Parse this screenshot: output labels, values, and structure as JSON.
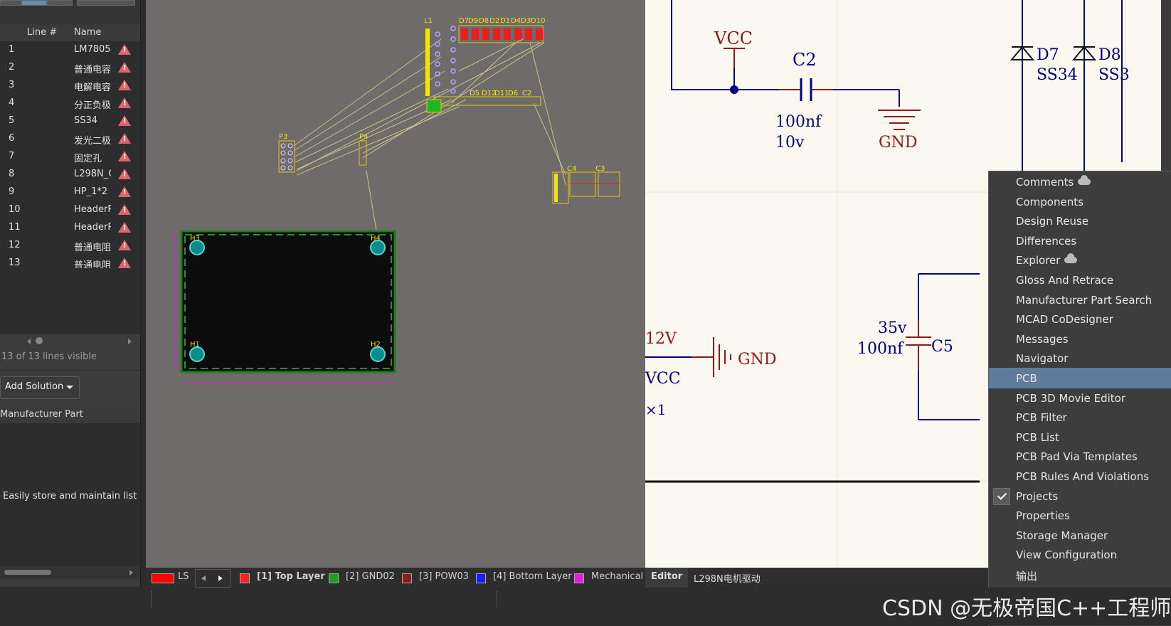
{
  "components_panel": {
    "columns": {
      "line": "Line #",
      "name": "Name"
    },
    "rows": [
      {
        "num": "1",
        "name": "LM7805"
      },
      {
        "num": "2",
        "name": "普通电容"
      },
      {
        "num": "3",
        "name": "电解电容"
      },
      {
        "num": "4",
        "name": "分正负极"
      },
      {
        "num": "5",
        "name": "SS34"
      },
      {
        "num": "6",
        "name": "发光二极"
      },
      {
        "num": "7",
        "name": "固定孔"
      },
      {
        "num": "8",
        "name": "L298N_C"
      },
      {
        "num": "9",
        "name": "HP_1*2"
      },
      {
        "num": "10",
        "name": "HeaderP"
      },
      {
        "num": "11",
        "name": "HeaderP"
      },
      {
        "num": "12",
        "name": "普通电阻"
      },
      {
        "num": "13",
        "name": "普通电阻"
      }
    ],
    "lines_visible": "13 of 13 lines visible",
    "add_solution": "Add Solution",
    "manufacturer_part": "Manufacturer Part",
    "hint": "Easily store and maintain list"
  },
  "pcb": {
    "labels": [
      "L1",
      "D7",
      "D9",
      "D8",
      "D2",
      "D1",
      "D4",
      "D3",
      "D10",
      "D5",
      "D12",
      "D11",
      "D6",
      "C2",
      "P3",
      "P4",
      "H3",
      "H4",
      "H1",
      "H2",
      "C4",
      "C3"
    ],
    "layer_tabs": [
      {
        "label": "LS",
        "color": "#ff0000"
      },
      {
        "label": "[1] Top Layer",
        "color": "#ff2020"
      },
      {
        "label": "[2] GND02",
        "color": "#1e9e1e"
      },
      {
        "label": "[3] POW03",
        "color": "#8b1a1a"
      },
      {
        "label": "[4] Bottom Layer",
        "color": "#1a1aff"
      },
      {
        "label": "Mechanical",
        "color": "#e01ee0"
      }
    ]
  },
  "schematic": {
    "texts": {
      "vcc_top": "VCC",
      "c2": "C2",
      "c2_val1": "100nf",
      "c2_val2": "10v",
      "gnd_top": "GND",
      "d7": "D7",
      "d7_val": "SS34",
      "d8": "D8",
      "d8_val": "SS3",
      "v12": "12V",
      "gnd_mid": "GND",
      "vcc_bot": "VCC",
      "x1": "×1",
      "c5_v": "35v",
      "c5_val": "100nf",
      "c5": "C5"
    }
  },
  "editor_tabs": {
    "editor": "Editor",
    "document": "L298N电机驱动"
  },
  "panels_menu": {
    "items": [
      {
        "label": "Comments",
        "cloud": true
      },
      {
        "label": "Components"
      },
      {
        "label": "Design Reuse"
      },
      {
        "label": "Differences"
      },
      {
        "label": "Explorer",
        "cloud": true
      },
      {
        "label": "Gloss And Retrace"
      },
      {
        "label": "Manufacturer Part Search"
      },
      {
        "label": "MCAD CoDesigner"
      },
      {
        "label": "Messages"
      },
      {
        "label": "Navigator"
      },
      {
        "label": "PCB",
        "selected": true
      },
      {
        "label": "PCB 3D Movie Editor"
      },
      {
        "label": "PCB Filter"
      },
      {
        "label": "PCB List"
      },
      {
        "label": "PCB Pad Via Templates"
      },
      {
        "label": "PCB Rules And Violations"
      },
      {
        "label": "Projects",
        "checked": true
      },
      {
        "label": "Properties"
      },
      {
        "label": "Storage Manager"
      },
      {
        "label": "View Configuration"
      },
      {
        "label": "输出"
      }
    ]
  },
  "watermark": "CSDN @无极帝国C++工程师"
}
